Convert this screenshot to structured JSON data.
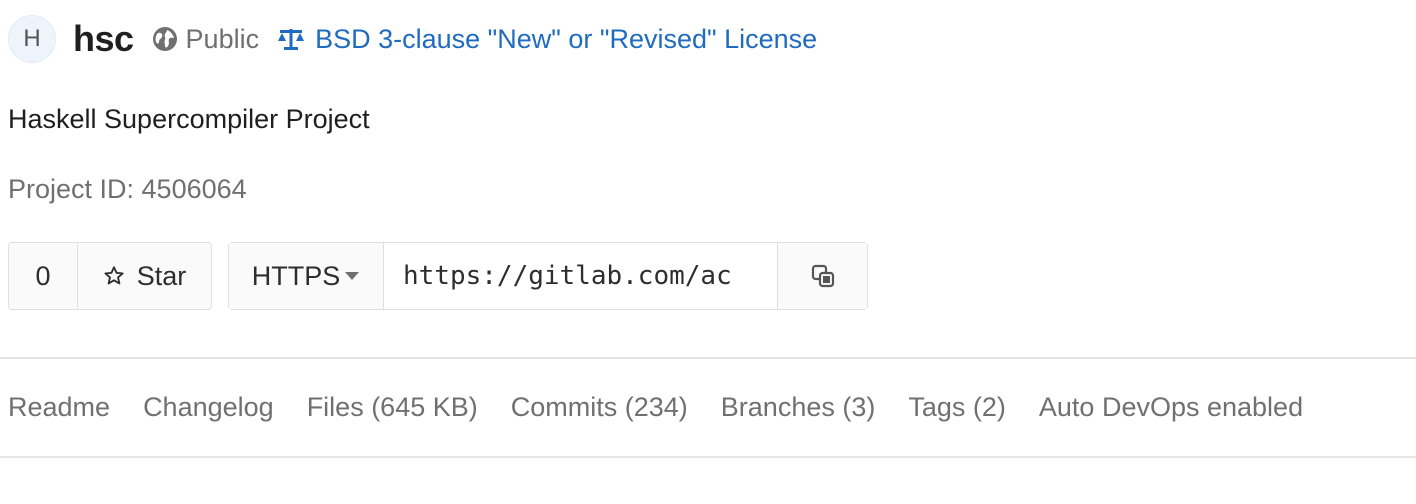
{
  "project": {
    "avatar_letter": "H",
    "name": "hsc",
    "visibility": "Public",
    "license": "BSD 3-clause \"New\" or \"Revised\" License",
    "description": "Haskell Supercompiler Project",
    "id_text": "Project ID: 4506064"
  },
  "star": {
    "count": "0",
    "label": "Star"
  },
  "clone": {
    "protocol": "HTTPS",
    "url": "https://gitlab.com/ac"
  },
  "stats": {
    "readme": "Readme",
    "changelog": "Changelog",
    "files": "Files (645 KB)",
    "commits": "Commits (234)",
    "branches": "Branches (3)",
    "tags": "Tags (2)",
    "auto_devops": "Auto DevOps enabled"
  },
  "icons": {
    "visibility": "globe-icon",
    "license": "scale-icon",
    "star": "star-outline-icon",
    "caret": "caret-down-icon",
    "copy": "copy-icon"
  },
  "colors": {
    "link": "#1f6bbf",
    "muted": "#707070",
    "text": "#2e2e2e",
    "border": "#e0e0e0"
  }
}
